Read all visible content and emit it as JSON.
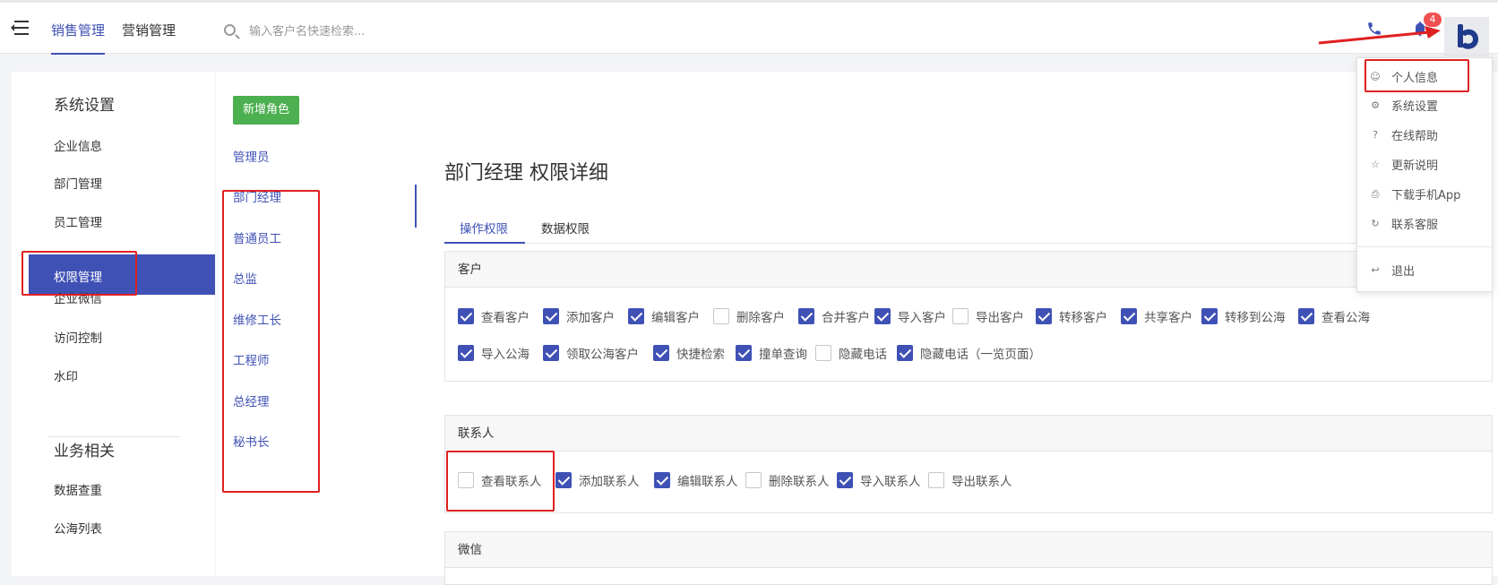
{
  "topbar": {
    "tabs": [
      {
        "label": "销售管理",
        "active": true
      },
      {
        "label": "营销管理",
        "active": false
      }
    ],
    "search_placeholder": "输入客户名快速检索...",
    "notification_count": "4",
    "accent_color": "#3f51b5"
  },
  "sidebar": {
    "section1_title": "系统设置",
    "items": [
      "企业信息",
      "部门管理",
      "员工管理",
      "权限管理",
      "企业微信",
      "访问控制",
      "水印"
    ],
    "active_item": "权限管理",
    "section2_title": "业务相关",
    "items2": [
      "数据查重",
      "公海列表"
    ]
  },
  "roles": {
    "add_button": "新增角色",
    "items": [
      "管理员",
      "部门经理",
      "普通员工",
      "总监",
      "维修工长",
      "工程师",
      "总经理",
      "秘书长"
    ]
  },
  "detail": {
    "title": "部门经理 权限详细",
    "tabs": [
      "操作权限",
      "数据权限"
    ],
    "active_tab": "操作权限"
  },
  "panels": {
    "customer": {
      "title": "客户",
      "perms": [
        {
          "label": "查看客户",
          "checked": true
        },
        {
          "label": "添加客户",
          "checked": true
        },
        {
          "label": "编辑客户",
          "checked": true
        },
        {
          "label": "删除客户",
          "checked": false
        },
        {
          "label": "合并客户",
          "checked": true
        },
        {
          "label": "导入客户",
          "checked": true
        },
        {
          "label": "导出客户",
          "checked": false
        },
        {
          "label": "转移客户",
          "checked": true
        },
        {
          "label": "共享客户",
          "checked": true
        },
        {
          "label": "转移到公海",
          "checked": true
        },
        {
          "label": "查看公海",
          "checked": true
        },
        {
          "label": "导入公海",
          "checked": true
        },
        {
          "label": "领取公海客户",
          "checked": true
        },
        {
          "label": "快捷检索",
          "checked": true
        },
        {
          "label": "撞单查询",
          "checked": true
        },
        {
          "label": "隐藏电话",
          "checked": false
        },
        {
          "label": "隐藏电话（一览页面）",
          "checked": true
        }
      ]
    },
    "contact": {
      "title": "联系人",
      "perms": [
        {
          "label": "查看联系人",
          "checked": false
        },
        {
          "label": "添加联系人",
          "checked": true
        },
        {
          "label": "编辑联系人",
          "checked": true
        },
        {
          "label": "删除联系人",
          "checked": false
        },
        {
          "label": "导入联系人",
          "checked": true
        },
        {
          "label": "导出联系人",
          "checked": false
        }
      ]
    },
    "wechat": {
      "title": "微信"
    }
  },
  "dropdown": {
    "items": [
      {
        "label": "个人信息",
        "icon": "user-icon"
      },
      {
        "label": "系统设置",
        "icon": "settings-icon"
      },
      {
        "label": "在线帮助",
        "icon": "help-icon"
      },
      {
        "label": "更新说明",
        "icon": "lightbulb-icon"
      },
      {
        "label": "下载手机App",
        "icon": "printer-icon"
      },
      {
        "label": "联系客服",
        "icon": "refresh-icon"
      },
      {
        "label": "退出",
        "icon": "logout-icon"
      }
    ]
  }
}
